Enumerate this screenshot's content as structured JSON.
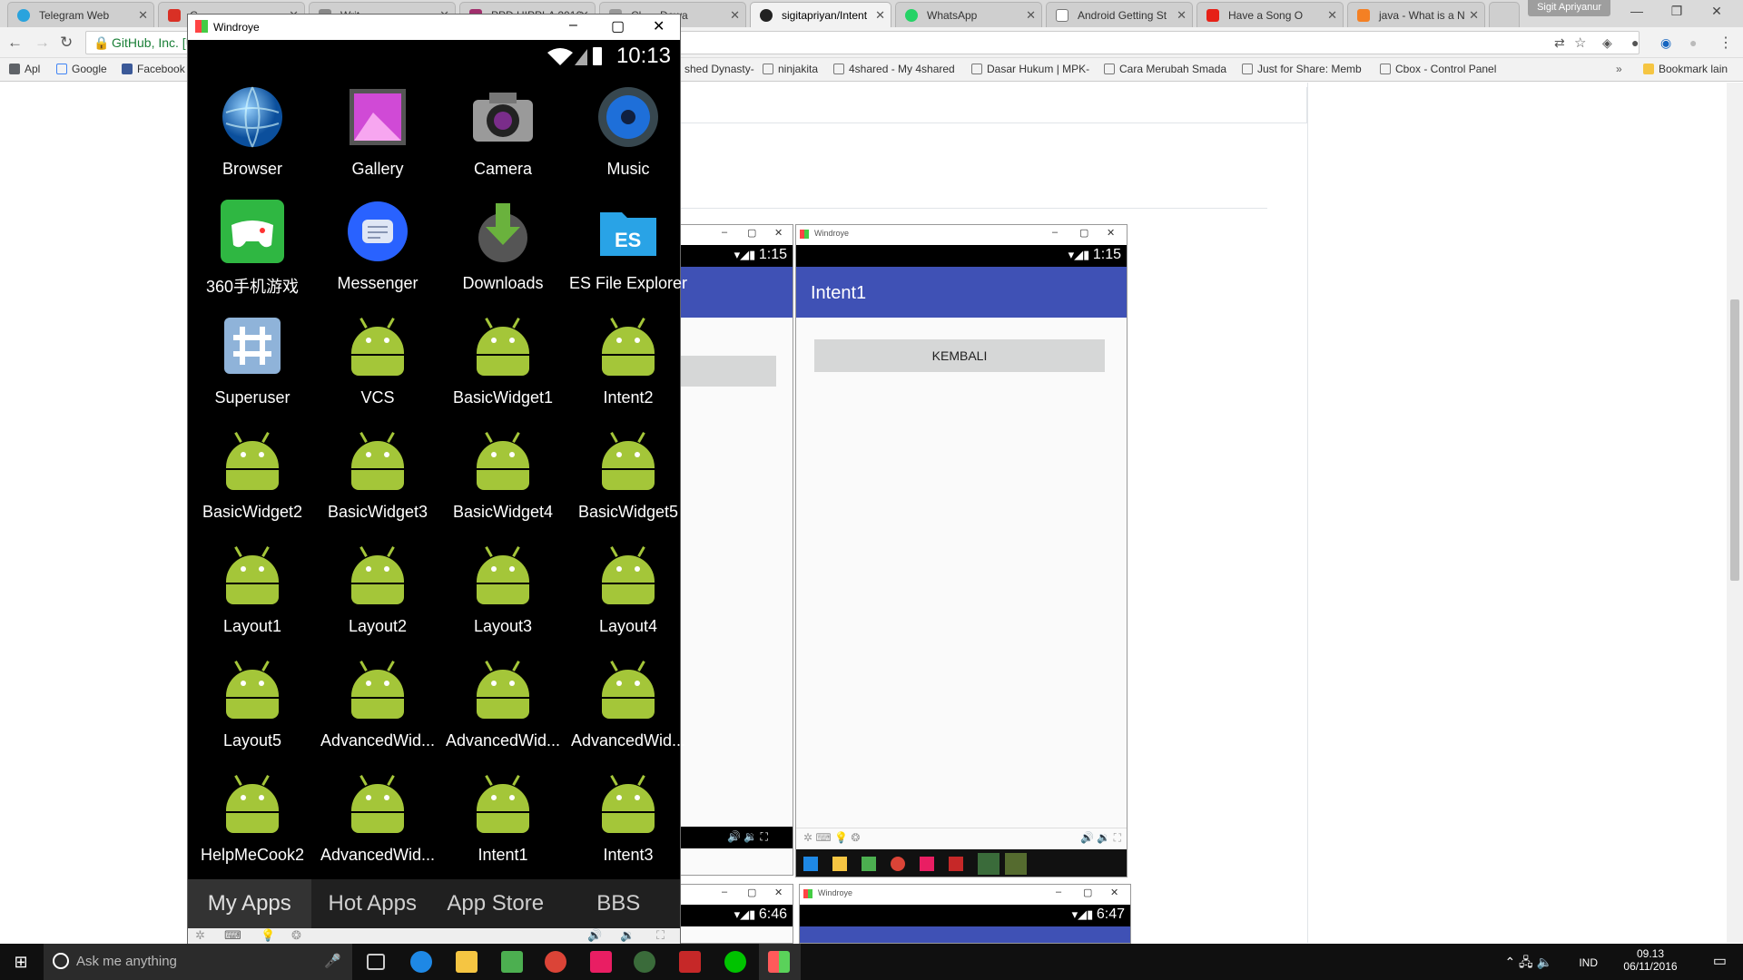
{
  "browser": {
    "tabs": [
      {
        "label": "Telegram Web",
        "color": "#2aa3dd"
      },
      {
        "label": "G...",
        "color": "#d93025"
      },
      {
        "label": "Writ...",
        "color": "#888888"
      },
      {
        "label": "PPD HIPPLA 2016",
        "color": "#a12f6d"
      },
      {
        "label": "Cl... - Dewa",
        "color": "#999999"
      },
      {
        "label": "sigitapriyan/Intent",
        "color": "#222222"
      },
      {
        "label": "WhatsApp",
        "color": "#25d366"
      },
      {
        "label": "Android Getting St",
        "color": "#777777"
      },
      {
        "label": "Have a Song O",
        "color": "#e62117"
      },
      {
        "label": "java - What is a N",
        "color": "#f48024"
      }
    ],
    "profile": "Sigit Apriyanur",
    "address": "GitHub, Inc. [U",
    "bookmarks": [
      "Apl",
      "Google",
      "Facebook",
      "shed Dynasty-",
      "ninjakita",
      "4shared - My 4shared",
      "Dasar Hukum | MPK-",
      "Cara Merubah Smada",
      "Just for Share: Memb",
      "Cbox - Control Panel"
    ],
    "other_bookmarks": "Bookmark lain"
  },
  "windroye": {
    "title": "Windroye",
    "time": "10:13",
    "apps": [
      {
        "label": "Browser",
        "icon": "globe-icon"
      },
      {
        "label": "Gallery",
        "icon": "gallery-icon"
      },
      {
        "label": "Camera",
        "icon": "camera-icon"
      },
      {
        "label": "Music",
        "icon": "music-icon"
      },
      {
        "label": "360手机游戏",
        "icon": "gamepad-icon"
      },
      {
        "label": "Messenger",
        "icon": "messenger-icon"
      },
      {
        "label": "Downloads",
        "icon": "download-icon"
      },
      {
        "label": "ES File Explorer",
        "icon": "es-file-explorer-icon"
      },
      {
        "label": "Superuser",
        "icon": "superuser-icon"
      },
      {
        "label": "VCS",
        "icon": "android-icon"
      },
      {
        "label": "BasicWidget1",
        "icon": "android-icon"
      },
      {
        "label": "Intent2",
        "icon": "android-icon"
      },
      {
        "label": "BasicWidget2",
        "icon": "android-icon"
      },
      {
        "label": "BasicWidget3",
        "icon": "android-icon"
      },
      {
        "label": "BasicWidget4",
        "icon": "android-icon"
      },
      {
        "label": "BasicWidget5",
        "icon": "android-icon"
      },
      {
        "label": "Layout1",
        "icon": "android-icon"
      },
      {
        "label": "Layout2",
        "icon": "android-icon"
      },
      {
        "label": "Layout3",
        "icon": "android-icon"
      },
      {
        "label": "Layout4",
        "icon": "android-icon"
      },
      {
        "label": "Layout5",
        "icon": "android-icon"
      },
      {
        "label": "AdvancedWid...",
        "icon": "android-icon"
      },
      {
        "label": "AdvancedWid...",
        "icon": "android-icon"
      },
      {
        "label": "AdvancedWid...",
        "icon": "android-icon"
      },
      {
        "label": "HelpMeCook2",
        "icon": "android-icon"
      },
      {
        "label": "AdvancedWid...",
        "icon": "android-icon"
      },
      {
        "label": "Intent1",
        "icon": "android-icon"
      },
      {
        "label": "Intent3",
        "icon": "android-icon"
      }
    ],
    "bottom_tabs": [
      "My Apps",
      "Hot Apps",
      "App Store",
      "BBS"
    ]
  },
  "bg_windows": {
    "left_time": "1:15",
    "right_title": "Windroye",
    "right_time": "1:15",
    "appbar_title": "Intent1",
    "button_label": "KEMBALI",
    "bottom_left_time": "6:46",
    "bottom_right_title": "Windroye",
    "bottom_right_time": "6:47"
  },
  "taskbar": {
    "search_placeholder": "Ask me anything",
    "lang": "IND",
    "time": "09.13",
    "date": "06/11/2016"
  },
  "colors": {
    "accent": "#3f51b5",
    "android_green": "#a4c639"
  }
}
